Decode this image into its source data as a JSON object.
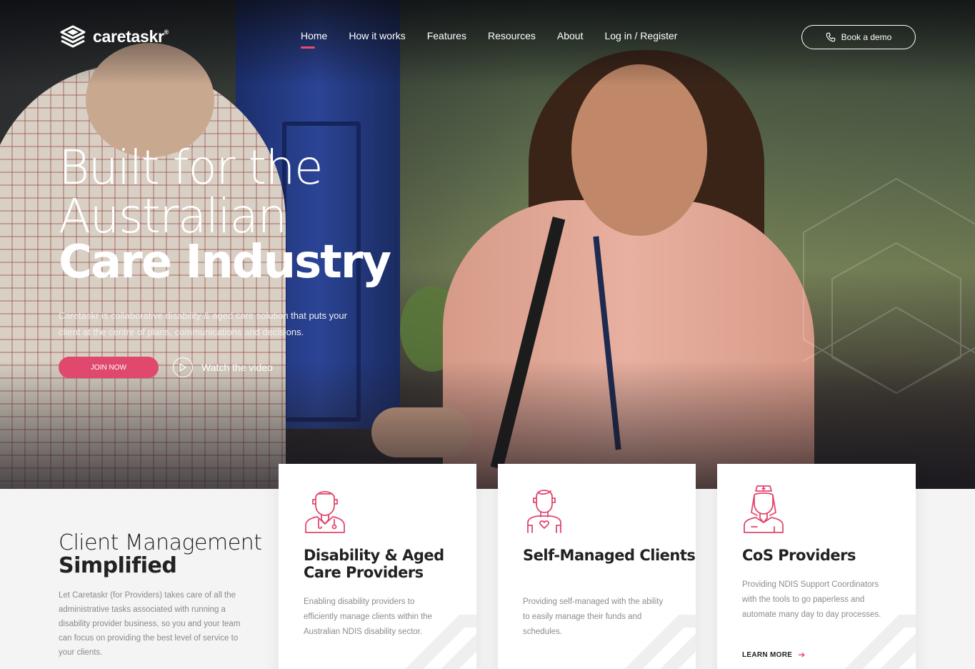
{
  "brand": {
    "name": "caretaskr",
    "mark": "®",
    "accent": "#e0486e"
  },
  "nav": {
    "items": [
      "Home",
      "How it works",
      "Features",
      "Resources",
      "About",
      "Log in / Register"
    ],
    "active": "Home",
    "demo_label": "Book a demo",
    "demo_icon": "phone-icon"
  },
  "hero": {
    "line1": "Built for the",
    "line2": "Australian",
    "line3": "Care Industry",
    "description": "Caretaskr is collaborative disability & aged care solution that puts your client at the centre of plans, communications and decisions.",
    "join_label": "JOIN NOW",
    "watch_label": "Watch the video",
    "watch_icon": "play-icon"
  },
  "section": {
    "title_light": "Client Management",
    "title_bold": "Simplified",
    "description": "Let Caretaskr (for Providers) takes care of all the administrative tasks associated with running a disability provider business, so you and your team can focus on providing the best level of service to your clients."
  },
  "cards": [
    {
      "icon": "doctor-icon",
      "title": "Disability & Aged Care Providers",
      "description": "Enabling disability providers to efficiently manage clients within the Australian NDIS disability sector.",
      "link": ""
    },
    {
      "icon": "client-icon",
      "title": "Self-Managed Clients",
      "description": "Providing self-managed with the ability to easily manage their funds and schedules.",
      "link": ""
    },
    {
      "icon": "nurse-icon",
      "title": "CoS Providers",
      "description": "Providing NDIS Support Coordinators with the tools to go paperless and automate many day to day processes.",
      "link": "LEARN MORE"
    }
  ]
}
